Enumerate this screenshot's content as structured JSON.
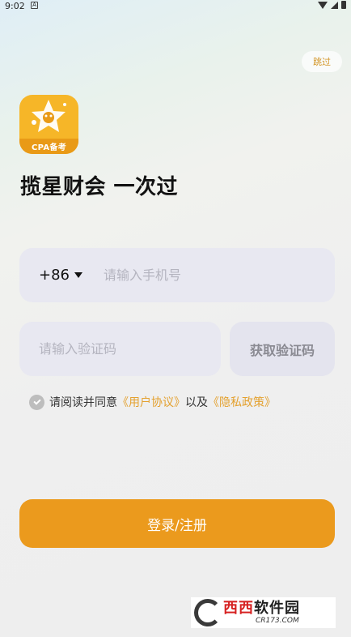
{
  "status_bar": {
    "time": "9:02",
    "notification": "A"
  },
  "skip_label": "跳过",
  "logo": {
    "band_text": "CPA备考"
  },
  "slogan": "揽星财会  一次过",
  "phone": {
    "country_code": "+86",
    "placeholder": "请输入手机号"
  },
  "code": {
    "placeholder": "请输入验证码",
    "get_code_label": "获取验证码"
  },
  "agreement": {
    "prefix": "请阅读并同意",
    "user_agreement": "《用户协议》",
    "and": "以及",
    "privacy_policy": "《隐私政策》",
    "checked": true
  },
  "login_label": "登录/注册",
  "watermark": {
    "title_red": "西西",
    "title_dark": "软件园",
    "subtitle": "CR173.COM"
  },
  "colors": {
    "accent": "#eb9a1d",
    "link": "#e4a12f",
    "field_bg": "#e8e8f1"
  },
  "icons": {
    "check": "check-icon",
    "caret": "caret-down-icon",
    "logo": "star-mascot-icon"
  }
}
